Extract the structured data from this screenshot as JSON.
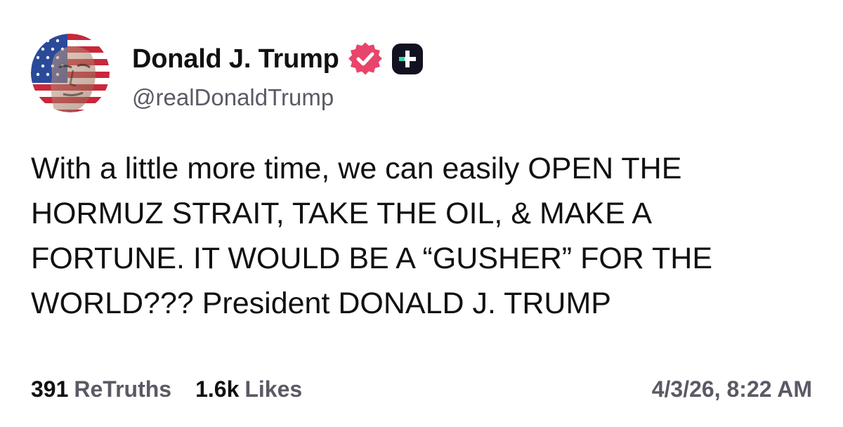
{
  "author": {
    "display_name": "Donald J. Trump",
    "handle": "@realDonaldTrump",
    "avatar_icon": "avatar-flag-portrait",
    "verified_icon": "verified-badge-icon",
    "badge_icon": "plus-badge-icon"
  },
  "post": {
    "text": "With a little more time, we can easily OPEN THE\nHORMUZ STRAIT, TAKE THE OIL, & MAKE A\nFORTUNE. IT WOULD BE A “GUSHER” FOR THE\nWORLD??? President DONALD J. TRUMP"
  },
  "stats": {
    "retruths_count": "391",
    "retruths_label": "ReTruths",
    "likes_count": "1.6k",
    "likes_label": "Likes",
    "timestamp": "4/3/26, 8:22 AM"
  },
  "colors": {
    "verified": "#e8456b",
    "badge_bg": "#111122",
    "badge_accent": "#36d6a8",
    "muted_text": "#5a5a66",
    "primary_text": "#111111"
  }
}
